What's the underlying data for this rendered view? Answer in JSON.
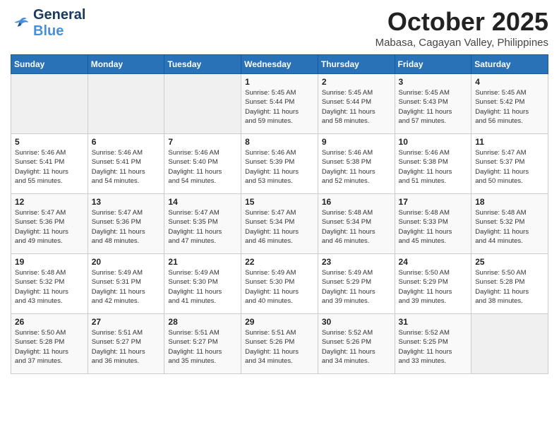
{
  "header": {
    "logo_line1": "General",
    "logo_line2": "Blue",
    "month": "October 2025",
    "location": "Mabasa, Cagayan Valley, Philippines"
  },
  "days_of_week": [
    "Sunday",
    "Monday",
    "Tuesday",
    "Wednesday",
    "Thursday",
    "Friday",
    "Saturday"
  ],
  "weeks": [
    [
      {
        "day": "",
        "info": ""
      },
      {
        "day": "",
        "info": ""
      },
      {
        "day": "",
        "info": ""
      },
      {
        "day": "1",
        "info": "Sunrise: 5:45 AM\nSunset: 5:44 PM\nDaylight: 11 hours\nand 59 minutes."
      },
      {
        "day": "2",
        "info": "Sunrise: 5:45 AM\nSunset: 5:44 PM\nDaylight: 11 hours\nand 58 minutes."
      },
      {
        "day": "3",
        "info": "Sunrise: 5:45 AM\nSunset: 5:43 PM\nDaylight: 11 hours\nand 57 minutes."
      },
      {
        "day": "4",
        "info": "Sunrise: 5:45 AM\nSunset: 5:42 PM\nDaylight: 11 hours\nand 56 minutes."
      }
    ],
    [
      {
        "day": "5",
        "info": "Sunrise: 5:46 AM\nSunset: 5:41 PM\nDaylight: 11 hours\nand 55 minutes."
      },
      {
        "day": "6",
        "info": "Sunrise: 5:46 AM\nSunset: 5:41 PM\nDaylight: 11 hours\nand 54 minutes."
      },
      {
        "day": "7",
        "info": "Sunrise: 5:46 AM\nSunset: 5:40 PM\nDaylight: 11 hours\nand 54 minutes."
      },
      {
        "day": "8",
        "info": "Sunrise: 5:46 AM\nSunset: 5:39 PM\nDaylight: 11 hours\nand 53 minutes."
      },
      {
        "day": "9",
        "info": "Sunrise: 5:46 AM\nSunset: 5:38 PM\nDaylight: 11 hours\nand 52 minutes."
      },
      {
        "day": "10",
        "info": "Sunrise: 5:46 AM\nSunset: 5:38 PM\nDaylight: 11 hours\nand 51 minutes."
      },
      {
        "day": "11",
        "info": "Sunrise: 5:47 AM\nSunset: 5:37 PM\nDaylight: 11 hours\nand 50 minutes."
      }
    ],
    [
      {
        "day": "12",
        "info": "Sunrise: 5:47 AM\nSunset: 5:36 PM\nDaylight: 11 hours\nand 49 minutes."
      },
      {
        "day": "13",
        "info": "Sunrise: 5:47 AM\nSunset: 5:36 PM\nDaylight: 11 hours\nand 48 minutes."
      },
      {
        "day": "14",
        "info": "Sunrise: 5:47 AM\nSunset: 5:35 PM\nDaylight: 11 hours\nand 47 minutes."
      },
      {
        "day": "15",
        "info": "Sunrise: 5:47 AM\nSunset: 5:34 PM\nDaylight: 11 hours\nand 46 minutes."
      },
      {
        "day": "16",
        "info": "Sunrise: 5:48 AM\nSunset: 5:34 PM\nDaylight: 11 hours\nand 46 minutes."
      },
      {
        "day": "17",
        "info": "Sunrise: 5:48 AM\nSunset: 5:33 PM\nDaylight: 11 hours\nand 45 minutes."
      },
      {
        "day": "18",
        "info": "Sunrise: 5:48 AM\nSunset: 5:32 PM\nDaylight: 11 hours\nand 44 minutes."
      }
    ],
    [
      {
        "day": "19",
        "info": "Sunrise: 5:48 AM\nSunset: 5:32 PM\nDaylight: 11 hours\nand 43 minutes."
      },
      {
        "day": "20",
        "info": "Sunrise: 5:49 AM\nSunset: 5:31 PM\nDaylight: 11 hours\nand 42 minutes."
      },
      {
        "day": "21",
        "info": "Sunrise: 5:49 AM\nSunset: 5:30 PM\nDaylight: 11 hours\nand 41 minutes."
      },
      {
        "day": "22",
        "info": "Sunrise: 5:49 AM\nSunset: 5:30 PM\nDaylight: 11 hours\nand 40 minutes."
      },
      {
        "day": "23",
        "info": "Sunrise: 5:49 AM\nSunset: 5:29 PM\nDaylight: 11 hours\nand 39 minutes."
      },
      {
        "day": "24",
        "info": "Sunrise: 5:50 AM\nSunset: 5:29 PM\nDaylight: 11 hours\nand 39 minutes."
      },
      {
        "day": "25",
        "info": "Sunrise: 5:50 AM\nSunset: 5:28 PM\nDaylight: 11 hours\nand 38 minutes."
      }
    ],
    [
      {
        "day": "26",
        "info": "Sunrise: 5:50 AM\nSunset: 5:28 PM\nDaylight: 11 hours\nand 37 minutes."
      },
      {
        "day": "27",
        "info": "Sunrise: 5:51 AM\nSunset: 5:27 PM\nDaylight: 11 hours\nand 36 minutes."
      },
      {
        "day": "28",
        "info": "Sunrise: 5:51 AM\nSunset: 5:27 PM\nDaylight: 11 hours\nand 35 minutes."
      },
      {
        "day": "29",
        "info": "Sunrise: 5:51 AM\nSunset: 5:26 PM\nDaylight: 11 hours\nand 34 minutes."
      },
      {
        "day": "30",
        "info": "Sunrise: 5:52 AM\nSunset: 5:26 PM\nDaylight: 11 hours\nand 34 minutes."
      },
      {
        "day": "31",
        "info": "Sunrise: 5:52 AM\nSunset: 5:25 PM\nDaylight: 11 hours\nand 33 minutes."
      },
      {
        "day": "",
        "info": ""
      }
    ]
  ]
}
